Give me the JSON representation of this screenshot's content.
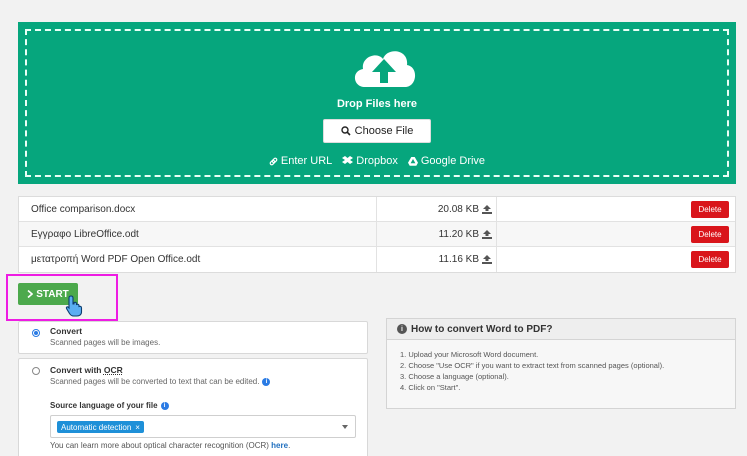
{
  "upload": {
    "drop_text": "Drop Files here",
    "choose_label": "Choose File",
    "links": [
      "Enter URL",
      "Dropbox",
      "Google Drive"
    ]
  },
  "files": [
    {
      "name": "Office comparison.docx",
      "size": "20.08 KB",
      "delete_label": "Delete"
    },
    {
      "name": "Εγγραφο LibreOffice.odt",
      "size": "11.20 KB",
      "delete_label": "Delete"
    },
    {
      "name": "μετατροπή Word PDF Open Office.odt",
      "size": "11.16 KB",
      "delete_label": "Delete"
    }
  ],
  "start": {
    "label": "START"
  },
  "options": {
    "convert": {
      "title": "Convert",
      "sub": "Scanned pages will be images."
    },
    "ocr": {
      "title_prefix": "Convert with ",
      "title_ocr": "OCR",
      "sub": "Scanned pages will be converted to text that can be edited.",
      "source_label": "Source language of your file",
      "tag": "Automatic detection",
      "tag_close": "×",
      "learn_text": "You can learn more about optical character recognition (OCR) ",
      "learn_link": "here",
      "learn_end": "."
    }
  },
  "howto": {
    "title": "How to convert Word to PDF?",
    "steps": [
      "1. Upload your Microsoft Word document.",
      "2. Choose \"Use OCR\" if you want to extract text from scanned pages (optional).",
      "3. Choose a language (optional).",
      "4. Click on \"Start\"."
    ]
  },
  "colors": {
    "accent_green": "#06a67d",
    "start_green": "#4ca94c",
    "delete_red": "#d9151b",
    "highlight_magenta": "#ee1ce3",
    "tag_blue": "#1e90d8"
  }
}
